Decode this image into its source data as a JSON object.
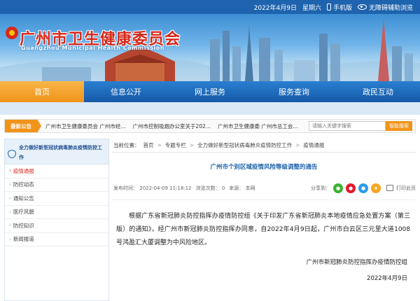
{
  "topbar": {
    "date": "2022年4月9日",
    "weekday": "星期六",
    "mobile": "手机版",
    "accessibility": "无障碍辅助浏览"
  },
  "banner": {
    "title_cn": "广州市卫生健康委员会",
    "title_en": "Guangzhou Municipal Health Commission"
  },
  "nav": {
    "items": [
      "首页",
      "信息公开",
      "网上服务",
      "服务查询",
      "政民互动"
    ],
    "active_index": 0
  },
  "notice": {
    "label": "最新公告",
    "items": [
      "广州市卫生健康委员会 广州市经...",
      "广州市控制吸烟办公室关于202...",
      "广州市卫生健康委 广州市总工会..."
    ],
    "search_placeholder": "请输入关键字搜索",
    "search_button": "智能搜索"
  },
  "sidebar": {
    "title": "全力做好新型冠状病毒肺炎疫情防控工作",
    "items": [
      "疫情通报",
      "防控动态",
      "通知公告",
      "医疗风貌",
      "防控知识",
      "新闻报道"
    ],
    "active_index": 0
  },
  "breadcrumb": {
    "items": [
      "当前位置：",
      "首页",
      "专题专栏",
      "全力做好新型冠状病毒肺炎疫情防控工作",
      "疫情通报"
    ],
    "separator": ">"
  },
  "article": {
    "title": "广州市个别区域疫情风险等级调整的通告",
    "publish_label": "发布时间：",
    "publish_time": "2022-04-09 11:18:12",
    "views_label": "浏览次数：",
    "views": "0",
    "source_label": "来源：",
    "source": "本网",
    "share_label": "分享到：",
    "print_label": "打印此页",
    "body": "根据广东省新冠肺炎防控指挥办疫情防控组《关于印发广东省新冠肺炎本地疫情应急处置方案（第三版）的通知》，经广州市新冠肺炎防控指挥办同意，自2022年4月9日起，广州市白云区三元里大道1008号鸿盈汇大厦调整为中风险地区。",
    "signature_org": "广州市新冠肺炎防控指挥办疫情防控组",
    "signature_date": "2022年4月9日"
  },
  "colors": {
    "primary_blue": "#1e63ad",
    "accent_orange": "#f0941a",
    "title_red": "#d6281b"
  }
}
